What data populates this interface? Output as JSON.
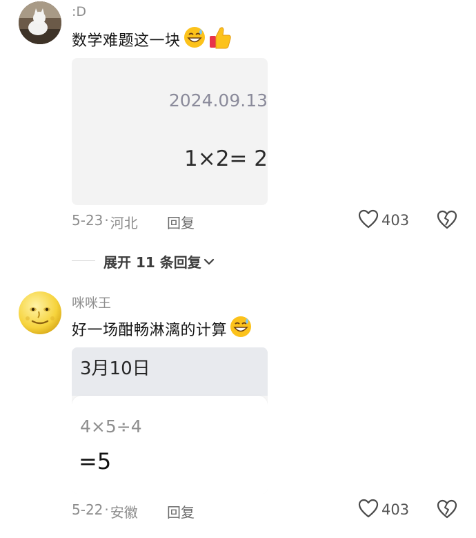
{
  "comments": [
    {
      "username": ":D",
      "text": "数学难题这一块",
      "emojis": [
        "grinning-sweat-icon",
        "thumbs-up-icon"
      ],
      "image": {
        "date": "2024.09.13",
        "equation": "1×2= 2"
      },
      "date": "5-23",
      "location": "河北",
      "reply_label": "回复",
      "likes": "403"
    },
    {
      "username": "咪咪王",
      "text": "好一场酣畅淋漓的计算",
      "emojis": [
        "grinning-sweat-icon"
      ],
      "image": {
        "date": "3月10日",
        "expression": "4×5÷4",
        "result": "=5"
      },
      "date": "5-22",
      "location": "安徽",
      "reply_label": "回复",
      "likes": "403"
    }
  ],
  "expand_replies": "展开 11 条回复",
  "separator": "·"
}
